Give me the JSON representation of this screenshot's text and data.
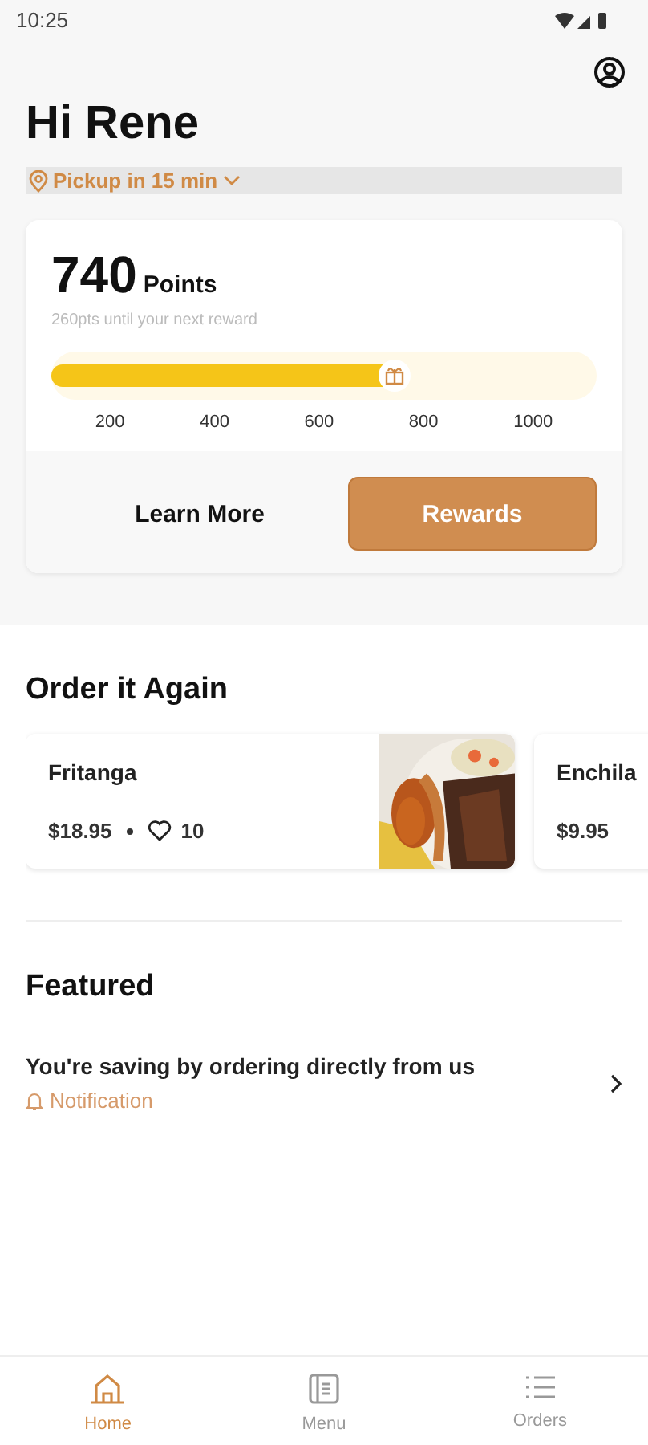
{
  "status_bar": {
    "time": "10:25"
  },
  "greeting": "Hi Rene",
  "pickup": {
    "label": "Pickup in 15 min"
  },
  "rewards": {
    "points": "740",
    "points_label": "Points",
    "subtitle": "260pts until your next reward",
    "level": 0.63,
    "ticks": [
      "200",
      "400",
      "600",
      "800",
      "1000"
    ],
    "learn_more": "Learn More",
    "rewards_button": "Rewards"
  },
  "order_again": {
    "title": "Order it Again",
    "items": [
      {
        "name": "Fritanga",
        "price": "$18.95",
        "likes": "10",
        "kind": "picture"
      },
      {
        "name": "Enchila",
        "price": "$9.95"
      }
    ]
  },
  "featured": {
    "title": "Featured",
    "items": [
      {
        "title": "You're saving by ordering directly from us",
        "tag": "Notification"
      }
    ]
  },
  "nav": [
    {
      "label": "Home",
      "selected": true
    },
    {
      "label": "Menu",
      "selected": false
    },
    {
      "label": "Orders",
      "selected": false
    }
  ]
}
